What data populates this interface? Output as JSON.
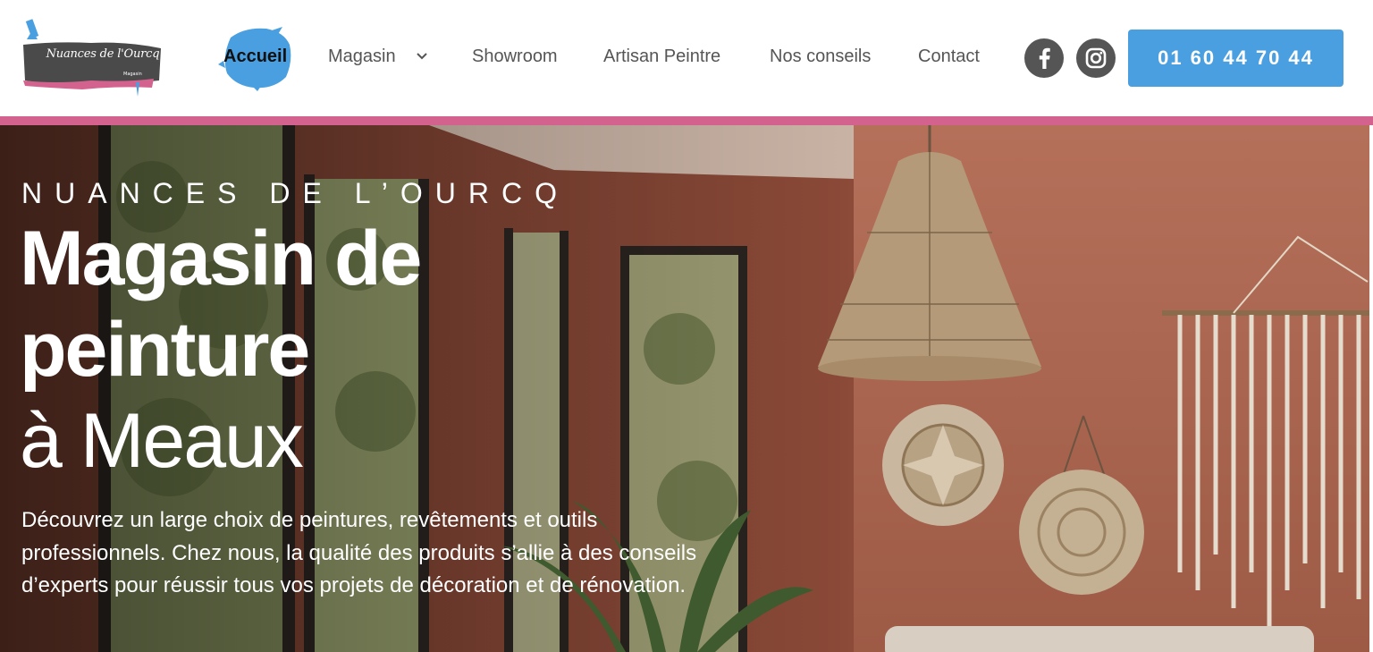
{
  "header": {
    "logo": {
      "title": "Nuances de l'Ourcq",
      "subtitle": "Magasin"
    },
    "nav": {
      "accueil": "Accueil",
      "magasin": "Magasin",
      "showroom": "Showroom",
      "artisan": "Artisan Peintre",
      "conseils": "Nos conseils",
      "contact": "Contact"
    },
    "social": {
      "facebook_icon": "facebook-icon",
      "instagram_icon": "instagram-icon"
    },
    "phone": "01 60 44 70 44"
  },
  "hero": {
    "eyebrow": "NUANCES DE L’OURCQ",
    "title_line1": "Magasin de",
    "title_line2": "peinture",
    "title_line3": "à Meaux",
    "description": "Découvrez un large choix de peintures, revêtements et outils professionnels. Chez nous, la qualité des produits s’allie à des conseils d’experts pour réussir tous vos projets de décoration et de rénovation."
  },
  "colors": {
    "accent_blue": "#4a9fe0",
    "accent_pink": "#d4628f",
    "terracotta": "#a55a45",
    "text_grey": "#555555"
  }
}
